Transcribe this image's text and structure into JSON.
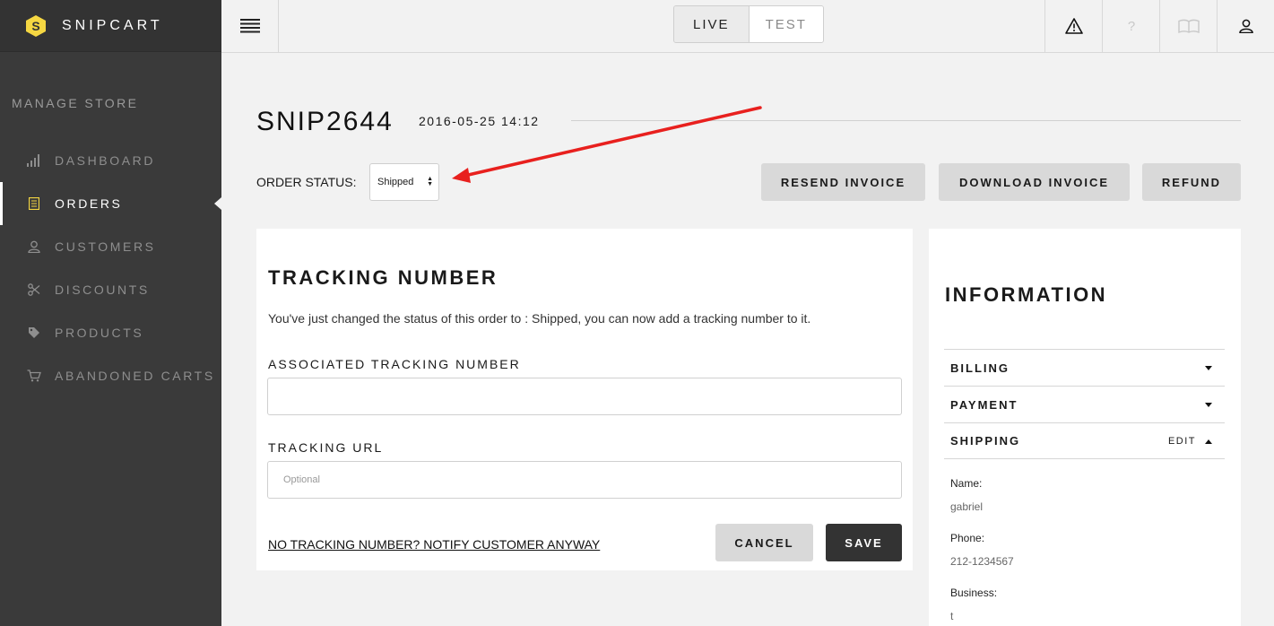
{
  "app": {
    "brand": "SNIPCART"
  },
  "sidebar": {
    "section_title": "MANAGE STORE",
    "items": [
      {
        "label": "DASHBOARD",
        "icon": "bar-chart-icon"
      },
      {
        "label": "ORDERS",
        "icon": "receipt-icon",
        "active": true
      },
      {
        "label": "CUSTOMERS",
        "icon": "user-icon"
      },
      {
        "label": "DISCOUNTS",
        "icon": "scissors-icon"
      },
      {
        "label": "PRODUCTS",
        "icon": "tag-icon"
      },
      {
        "label": "ABANDONED CARTS",
        "icon": "cart-icon"
      }
    ]
  },
  "topbar": {
    "env": {
      "live": "LIVE",
      "test": "TEST",
      "selected": "LIVE"
    },
    "icons": [
      "warning-icon",
      "help-icon",
      "book-icon",
      "account-icon"
    ]
  },
  "order": {
    "id": "SNIP2644",
    "date": "2016-05-25 14:12",
    "status_label": "ORDER STATUS:",
    "status_value": "Shipped",
    "actions": {
      "resend": "RESEND INVOICE",
      "download": "DOWNLOAD INVOICE",
      "refund": "REFUND"
    }
  },
  "tracking": {
    "title": "TRACKING NUMBER",
    "message": "You've just changed the status of this order to : Shipped, you can now add a tracking number to it.",
    "number_label": "ASSOCIATED TRACKING NUMBER",
    "number_value": "",
    "url_label": "TRACKING URL",
    "url_placeholder": "Optional",
    "notify_link": "NO TRACKING NUMBER? NOTIFY CUSTOMER ANYWAY",
    "cancel": "CANCEL",
    "save": "SAVE"
  },
  "information": {
    "title": "INFORMATION",
    "sections": {
      "billing": "BILLING",
      "payment": "PAYMENT",
      "shipping": "SHIPPING",
      "edit": "EDIT"
    },
    "shipping": {
      "name_label": "Name:",
      "name": "gabriel",
      "phone_label": "Phone:",
      "phone": "212-1234567",
      "business_label": "Business:",
      "business": "t"
    }
  },
  "colors": {
    "sidebar_bg": "#3a3a3a",
    "logo": "#f5d742",
    "annotation_arrow": "#e8201e",
    "save_bg": "#333333"
  }
}
